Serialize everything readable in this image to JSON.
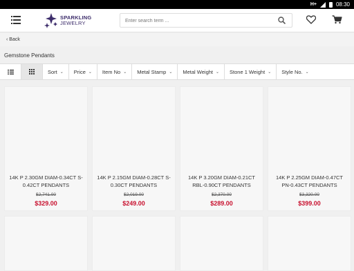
{
  "status": {
    "network": "H+",
    "time": "08:30"
  },
  "header": {
    "logo_line1": "SPARKLING",
    "logo_line2": "JEWELRY",
    "search_placeholder": "Enter search term ..."
  },
  "nav": {
    "back_label": "Back"
  },
  "page": {
    "title": "Gemstone Pendants"
  },
  "filters": [
    "Sort",
    "Price",
    "Item No",
    "Metal Stamp",
    "Metal Weight",
    "Stone 1 Weight",
    "Style No."
  ],
  "colors": {
    "price": "#c8102e",
    "logo": "#3d2d6b"
  },
  "products": [
    {
      "name": "14K P 2.30GM DIAM-0.34CT S-0.42CT PENDANTS",
      "old_price": "$2,741.00",
      "price": "$329.00"
    },
    {
      "name": "14K P 2.15GM DIAM-0.28CT S-0.30CT PENDANTS",
      "old_price": "$2,019.00",
      "price": "$249.00"
    },
    {
      "name": "14K P 3.20GM DIAM-0.21CT RBL-0.90CT PENDANTS",
      "old_price": "$2,370.00",
      "price": "$289.00"
    },
    {
      "name": "14K P 2.25GM DIAM-0.47CT PN-0.43CT PENDANTS",
      "old_price": "$3,320.00",
      "price": "$399.00"
    }
  ]
}
